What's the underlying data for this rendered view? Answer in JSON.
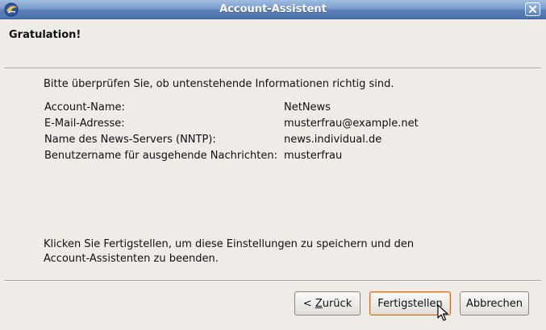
{
  "window": {
    "title": "Account-Assistent",
    "app_icon": "thunderbird-icon",
    "close_icon": "close-icon"
  },
  "page": {
    "heading": "Gratulation!",
    "intro": "Bitte überprüfen Sie, ob untenstehende Informationen richtig sind.",
    "info": [
      {
        "label": "Account-Name:",
        "value": "NetNews"
      },
      {
        "label": "E-Mail-Adresse:",
        "value": "musterfrau@example.net"
      },
      {
        "label": "Name des News-Servers (NNTP):",
        "value": "news.individual.de"
      },
      {
        "label": "Benutzername für ausgehende Nachrichten:",
        "value": "musterfrau"
      }
    ],
    "outro_line1": "Klicken Sie Fertigstellen, um diese Einstellungen zu speichern und den",
    "outro_line2": "Account-Assistenten zu beenden."
  },
  "buttons": {
    "back_prefix": "< ",
    "back_mnemonic": "Z",
    "back_rest": "urück",
    "finish": "Fertigstellen",
    "cancel": "Abbrechen"
  },
  "colors": {
    "titlebar": "#5b80b8",
    "window_bg": "#efebe7",
    "default_button_border": "#c96f2e"
  }
}
